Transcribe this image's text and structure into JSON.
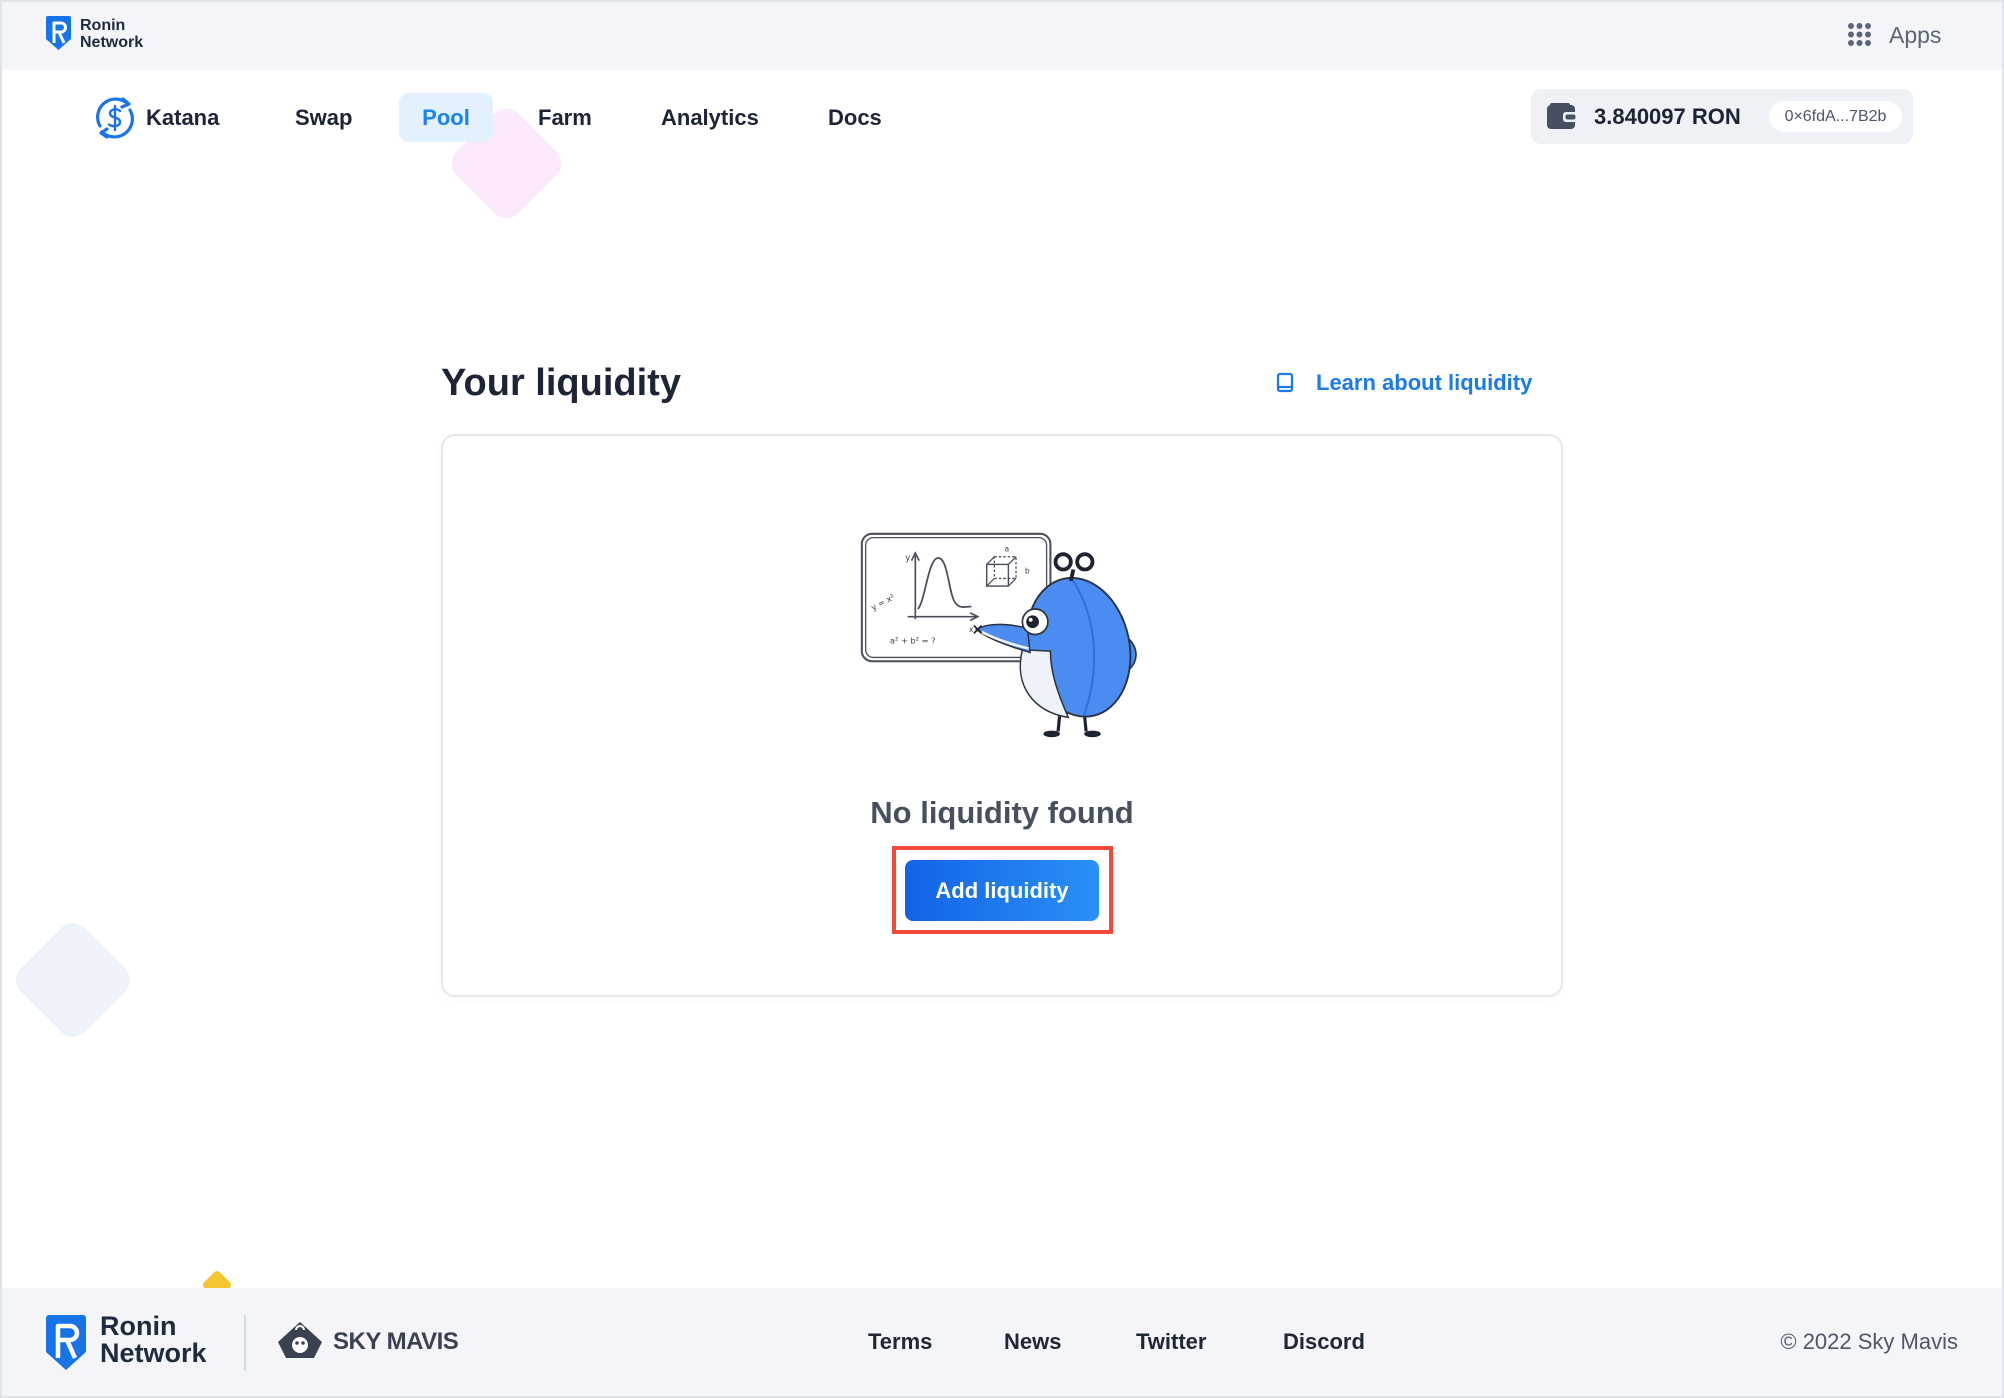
{
  "top_bar": {
    "brand_line1": "Ronin",
    "brand_line2": "Network",
    "apps_label": "Apps"
  },
  "nav": {
    "logo_label": "Katana",
    "active_item": "Pool",
    "items": [
      {
        "label": "Swap"
      },
      {
        "label": "Pool"
      },
      {
        "label": "Farm"
      },
      {
        "label": "Analytics"
      },
      {
        "label": "Docs"
      }
    ]
  },
  "wallet": {
    "balance": "3.840097 RON",
    "address": "0×6fdA...7B2b"
  },
  "main": {
    "title": "Your liquidity",
    "learn_link": "Learn about liquidity",
    "empty_state": "No liquidity found",
    "add_button": "Add liquidity",
    "illustration": {
      "axis_y": "y",
      "axis_x": "x",
      "formula_curve": "y = x²",
      "formula_pythagoras": "a² + b² = ?",
      "cube_a": "a",
      "cube_b": "b"
    }
  },
  "footer": {
    "brand_line1": "Ronin",
    "brand_line2": "Network",
    "partner_logo": "SKY MAVIS",
    "links": [
      "Terms",
      "News",
      "Twitter",
      "Discord"
    ],
    "copyright": "© 2022 Sky Mavis"
  },
  "icons": {
    "brand": "ronin-shield-icon",
    "apps": "apps-grid-icon",
    "katana": "katana-logo-icon",
    "wallet": "wallet-icon",
    "learn": "book-icon",
    "partner": "sky-mavis-icon"
  },
  "colors": {
    "accent": "#1a7ae8",
    "brand_blue": "#1773e8",
    "active_pill_bg": "#e3f0fd",
    "button_start": "#1263e6",
    "button_end": "#2a90f6",
    "highlight_border": "#ee4b3b",
    "text_primary": "#1c2436"
  }
}
